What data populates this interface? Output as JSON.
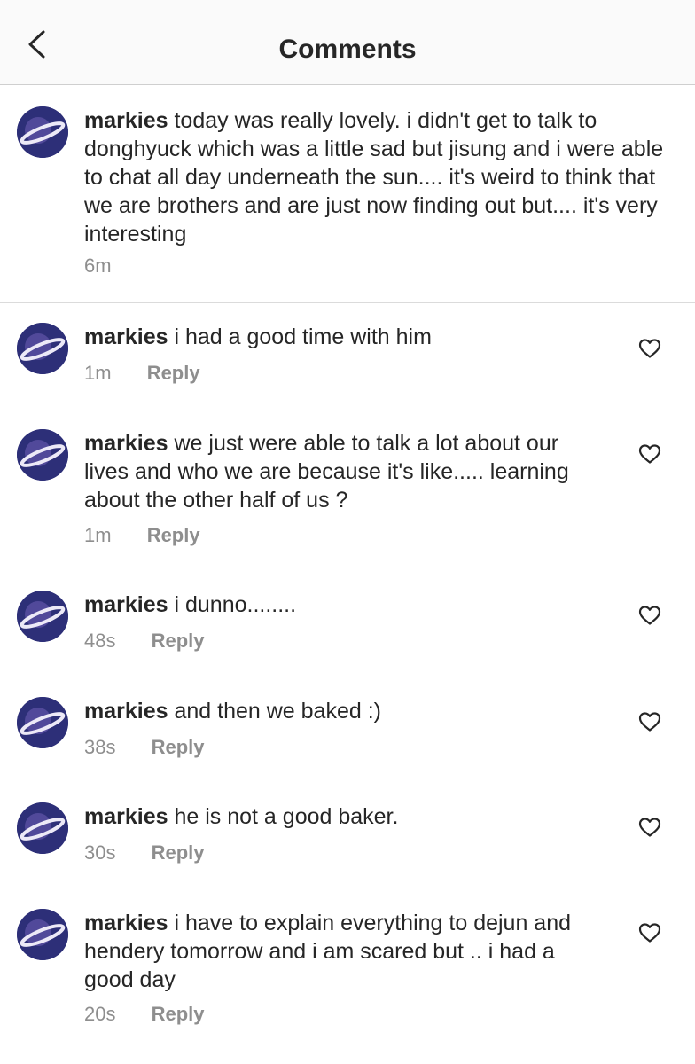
{
  "header": {
    "title": "Comments",
    "back_icon": "chevron-left-icon"
  },
  "caption": {
    "username": "markies",
    "text": "today was really lovely. i didn't get to talk to donghyuck which was a little sad but jisung and i were able to chat all day underneath the sun.... it's weird to think that we are brothers and are just now finding out but.... it's very interesting",
    "time": "6m"
  },
  "comments": [
    {
      "username": "markies",
      "text": "i had a good time with him",
      "time": "1m",
      "reply_label": "Reply",
      "like_icon": "heart-outline-icon"
    },
    {
      "username": "markies",
      "text": "we just were able to talk a lot about our lives and who we are because it's like..... learning about the other half of us ?",
      "time": "1m",
      "reply_label": "Reply",
      "like_icon": "heart-outline-icon"
    },
    {
      "username": "markies",
      "text": "i dunno........",
      "time": "48s",
      "reply_label": "Reply",
      "like_icon": "heart-outline-icon"
    },
    {
      "username": "markies",
      "text": "and then we baked :)",
      "time": "38s",
      "reply_label": "Reply",
      "like_icon": "heart-outline-icon"
    },
    {
      "username": "markies",
      "text": "he is not a good baker.",
      "time": "30s",
      "reply_label": "Reply",
      "like_icon": "heart-outline-icon"
    },
    {
      "username": "markies",
      "text": "i have to explain everything to dejun and hendery tomorrow and i am scared but .. i had a good day",
      "time": "20s",
      "reply_label": "Reply",
      "like_icon": "heart-outline-icon"
    }
  ],
  "colors": {
    "text": "#262626",
    "secondary": "#8e8e8e",
    "header_bg": "#fafafa",
    "divider": "#dbdbdb",
    "avatar_bg": "#2d2f78",
    "avatar_ring": "#e8e6f4"
  }
}
